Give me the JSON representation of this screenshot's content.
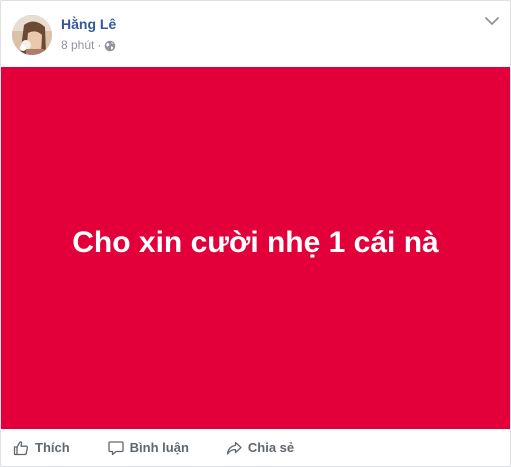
{
  "post": {
    "author": {
      "name": "Hằng Lê",
      "avatar_icon": "profile-photo"
    },
    "meta": {
      "time": "8 phút",
      "separator": "·",
      "privacy_icon": "globe-icon"
    },
    "more_icon": "chevron-down-icon",
    "card": {
      "text": "Cho xin cười nhẹ 1 cái nà",
      "background_color": "#e3003a",
      "text_color": "#ffffff"
    },
    "actions": {
      "like_label": "Thích",
      "comment_label": "Bình luận",
      "share_label": "Chia sẻ"
    }
  },
  "colors": {
    "name_link": "#365899",
    "meta_gray": "#90949c",
    "action_gray": "#606770"
  }
}
